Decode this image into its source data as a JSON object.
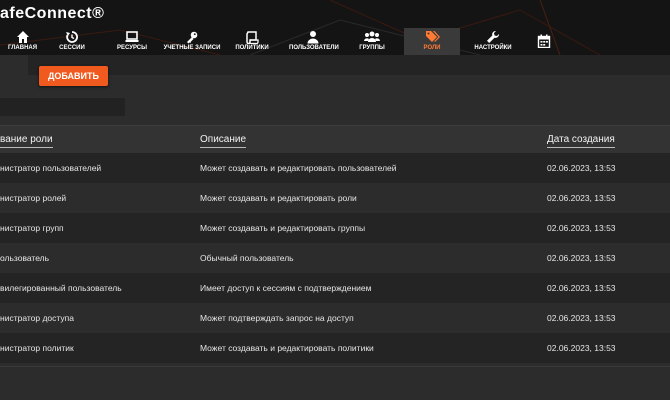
{
  "app": {
    "title": "afeConnect®"
  },
  "nav": {
    "items": [
      {
        "label": "главная",
        "icon": "home-icon"
      },
      {
        "label": "сессии",
        "icon": "history-icon"
      },
      {
        "label": "ресурсы",
        "icon": "monitor-icon"
      },
      {
        "label": "учетные записи",
        "icon": "key-icon"
      },
      {
        "label": "политики",
        "icon": "scroll-icon"
      },
      {
        "label": "пользователи",
        "icon": "user-icon"
      },
      {
        "label": "группы",
        "icon": "users-icon"
      },
      {
        "label": "роли",
        "icon": "tags-icon",
        "active": true
      },
      {
        "label": "настройки",
        "icon": "wrench-icon"
      },
      {
        "label": "",
        "icon": "calendar-icon"
      }
    ],
    "active_color": "#ff7a33"
  },
  "toolbar": {
    "add_label": "ДОБАВИТЬ",
    "accent": "#f05a1e"
  },
  "search": {
    "value": "",
    "placeholder": ""
  },
  "table": {
    "columns": [
      "вание роли",
      "Описание",
      "Дата создания"
    ],
    "rows": [
      {
        "name": "нистратор пользователей",
        "description": "Может создавать и редактировать пользователей",
        "created": "02.06.2023, 13:53"
      },
      {
        "name": "нистратор ролей",
        "description": "Может создавать и редактировать роли",
        "created": "02.06.2023, 13:53"
      },
      {
        "name": "нистратор групп",
        "description": "Может создавать и редактировать группы",
        "created": "02.06.2023, 13:53"
      },
      {
        "name": "ользователь",
        "description": "Обычный пользователь",
        "created": "02.06.2023, 13:53"
      },
      {
        "name": "вилегированный пользователь",
        "description": "Имеет доступ к сессиям с подтверждением",
        "created": "02.06.2023, 13:53"
      },
      {
        "name": "нистратор доступа",
        "description": "Может подтверждать запрос на доступ",
        "created": "02.06.2023, 13:53"
      },
      {
        "name": "нистратор политик",
        "description": "Может создавать и редактировать политики",
        "created": "02.06.2023, 13:53"
      }
    ]
  }
}
